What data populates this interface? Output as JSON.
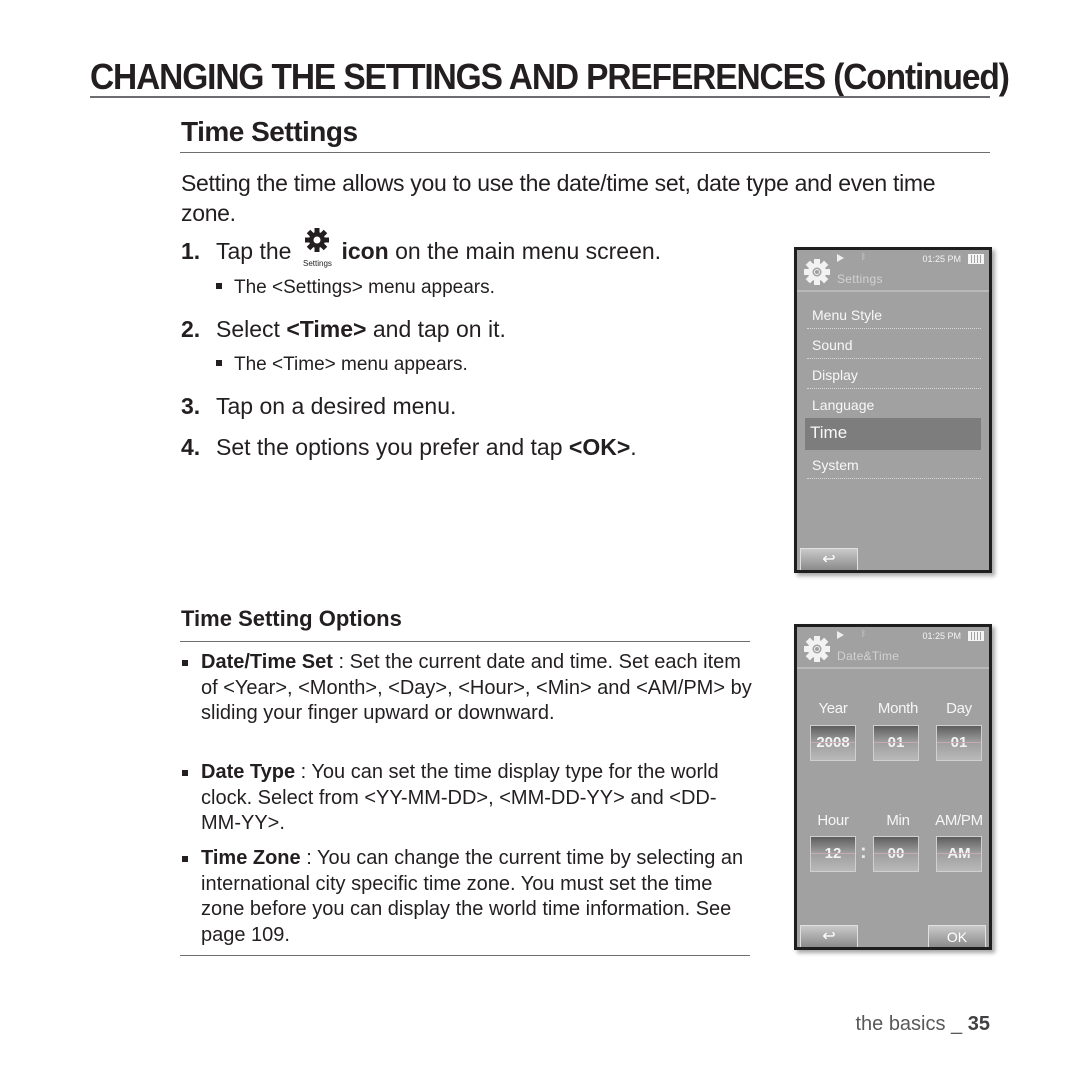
{
  "page": {
    "title": "CHANGING THE SETTINGS AND PREFERENCES (Continued)",
    "section_title": "Time Settings",
    "intro": "Setting the time allows you to use the date/time set, date type and even time zone.",
    "steps": [
      {
        "num": "1.",
        "pre": "Tap the",
        "icon_caption": "Settings",
        "bold": "icon",
        "post": " on the main menu screen."
      },
      {
        "num": "2.",
        "pre": "Select ",
        "bold": "<Time>",
        "post": " and tap on it."
      },
      {
        "num": "3.",
        "text": "Tap on a desired menu."
      },
      {
        "num": "4.",
        "pre": "Set the options you prefer and tap ",
        "bold": "<OK>",
        "post": "."
      }
    ],
    "substeps": [
      "The <Settings> menu appears.",
      "The <Time> menu appears."
    ],
    "options_title": "Time Setting Options",
    "options": [
      {
        "term": "Date/Time Set",
        "desc": " : Set the current date and time. Set each item of <Year>, <Month>, <Day>, <Hour>, <Min> and <AM/PM> by sliding your finger upward or downward."
      },
      {
        "term": "Date Type",
        "desc": " : You can set the time display type for the world clock. Select from <YY-MM-DD>, <MM-DD-YY> and <DD-MM-YY>."
      },
      {
        "term": "Time Zone",
        "desc": " : You can change the current time by selecting an international city specific time zone. You must set the time zone before you can display the world time information. See page 109."
      }
    ],
    "footer": {
      "section": "the basics _ ",
      "page_number": "35"
    }
  },
  "device_settings": {
    "status_time": "01:25 PM",
    "header_title": "Settings",
    "menu": [
      {
        "label": "Menu Style",
        "selected": false
      },
      {
        "label": "Sound",
        "selected": false
      },
      {
        "label": "Display",
        "selected": false
      },
      {
        "label": "Language",
        "selected": false
      },
      {
        "label": "Time",
        "selected": true
      },
      {
        "label": "System",
        "selected": false
      }
    ],
    "back_icon": "↩"
  },
  "device_datetime": {
    "status_time": "01:25 PM",
    "header_title": "Date&Time",
    "fields": [
      {
        "label": "Year",
        "value": "2008"
      },
      {
        "label": "Month",
        "value": "01"
      },
      {
        "label": "Day",
        "value": "01"
      },
      {
        "label": "Hour",
        "value": "12"
      },
      {
        "label": "Min",
        "value": "00"
      },
      {
        "label": "AM/PM",
        "value": "AM"
      }
    ],
    "colon": ":",
    "back_icon": "↩",
    "ok_label": "OK"
  },
  "icons": {
    "gear": "gear-icon",
    "play": "play-icon",
    "bluetooth": "bluetooth-icon",
    "battery": "battery-icon",
    "back": "back-arrow-icon"
  }
}
